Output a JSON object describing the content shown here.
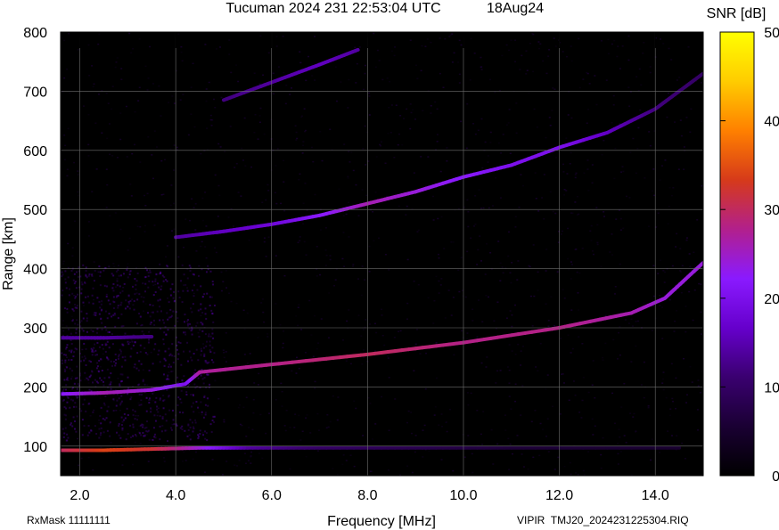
{
  "chart_data": {
    "type": "heatmap",
    "title": "Tucuman 2024 231 22:53:04 UTC",
    "date_label": "18Aug24",
    "xlabel": "Frequency [MHz]",
    "ylabel": "Range [km]",
    "colorbar_label": "SNR [dB]",
    "xlim": [
      1.6,
      15.0
    ],
    "ylim": [
      50,
      800
    ],
    "clim": [
      0,
      50
    ],
    "x_ticks": [
      {
        "value": 2,
        "label": "2.0"
      },
      {
        "value": 4,
        "label": "4.0"
      },
      {
        "value": 6,
        "label": "6.0"
      },
      {
        "value": 8,
        "label": "8.0"
      },
      {
        "value": 10,
        "label": "10.0"
      },
      {
        "value": 12,
        "label": "12.0"
      },
      {
        "value": 14,
        "label": "14.0"
      }
    ],
    "y_ticks": [
      {
        "value": 100,
        "label": "100"
      },
      {
        "value": 200,
        "label": "200"
      },
      {
        "value": 300,
        "label": "300"
      },
      {
        "value": 400,
        "label": "400"
      },
      {
        "value": 500,
        "label": "500"
      },
      {
        "value": 600,
        "label": "600"
      },
      {
        "value": 700,
        "label": "700"
      },
      {
        "value": 800,
        "label": "800"
      }
    ],
    "colorbar_ticks": [
      {
        "value": 0,
        "label": "0"
      },
      {
        "value": 10,
        "label": "10"
      },
      {
        "value": 20,
        "label": "20"
      },
      {
        "value": 30,
        "label": "30"
      },
      {
        "value": 40,
        "label": "40"
      },
      {
        "value": 50,
        "label": "50"
      }
    ],
    "colormap": [
      "#000000",
      "#1a0033",
      "#3a0070",
      "#6600cc",
      "#8a1aff",
      "#b2208c",
      "#d63a1a",
      "#ff8000",
      "#ffcc00",
      "#ffff00"
    ],
    "grid": true,
    "traces": [
      {
        "points": [
          [
            1.6,
            93
          ],
          [
            2.5,
            93
          ],
          [
            3.5,
            95
          ],
          [
            4.5,
            97
          ],
          [
            5.5,
            97
          ],
          [
            7.0,
            97
          ],
          [
            9.0,
            97
          ],
          [
            11.0,
            97
          ],
          [
            14.5,
            97
          ]
        ],
        "snr": [
          30,
          34,
          32,
          24,
          14,
          10,
          8,
          6,
          5
        ]
      },
      {
        "points": [
          [
            1.6,
            188
          ],
          [
            2.5,
            190
          ],
          [
            3.5,
            195
          ],
          [
            4.2,
            205
          ],
          [
            4.5,
            225
          ],
          [
            6.0,
            238
          ],
          [
            8.0,
            255
          ],
          [
            10.0,
            275
          ],
          [
            12.0,
            300
          ],
          [
            13.5,
            325
          ],
          [
            14.2,
            350
          ],
          [
            15.0,
            410
          ]
        ],
        "snr": [
          22,
          26,
          24,
          20,
          27,
          28,
          30,
          28,
          28,
          26,
          24,
          24
        ]
      },
      {
        "points": [
          [
            1.6,
            283
          ],
          [
            2.5,
            283
          ],
          [
            3.5,
            285
          ]
        ],
        "snr": [
          14,
          14,
          12
        ]
      },
      {
        "points": [
          [
            4.0,
            453
          ],
          [
            5.0,
            463
          ],
          [
            6.0,
            475
          ],
          [
            7.0,
            490
          ],
          [
            8.0,
            510
          ],
          [
            9.0,
            530
          ],
          [
            10.0,
            555
          ],
          [
            11.0,
            575
          ],
          [
            12.0,
            605
          ],
          [
            13.0,
            630
          ],
          [
            14.0,
            670
          ],
          [
            15.0,
            730
          ]
        ],
        "snr": [
          14,
          16,
          18,
          22,
          26,
          24,
          22,
          20,
          20,
          16,
          12,
          10
        ]
      },
      {
        "points": [
          [
            5.0,
            685
          ],
          [
            6.0,
            715
          ],
          [
            7.0,
            745
          ],
          [
            7.8,
            770
          ]
        ],
        "snr": [
          12,
          14,
          16,
          14
        ]
      }
    ]
  },
  "footer": {
    "rxmask": "RxMask 11111111",
    "file": "VIPIR  TMJ20_2024231225304.RIQ"
  }
}
